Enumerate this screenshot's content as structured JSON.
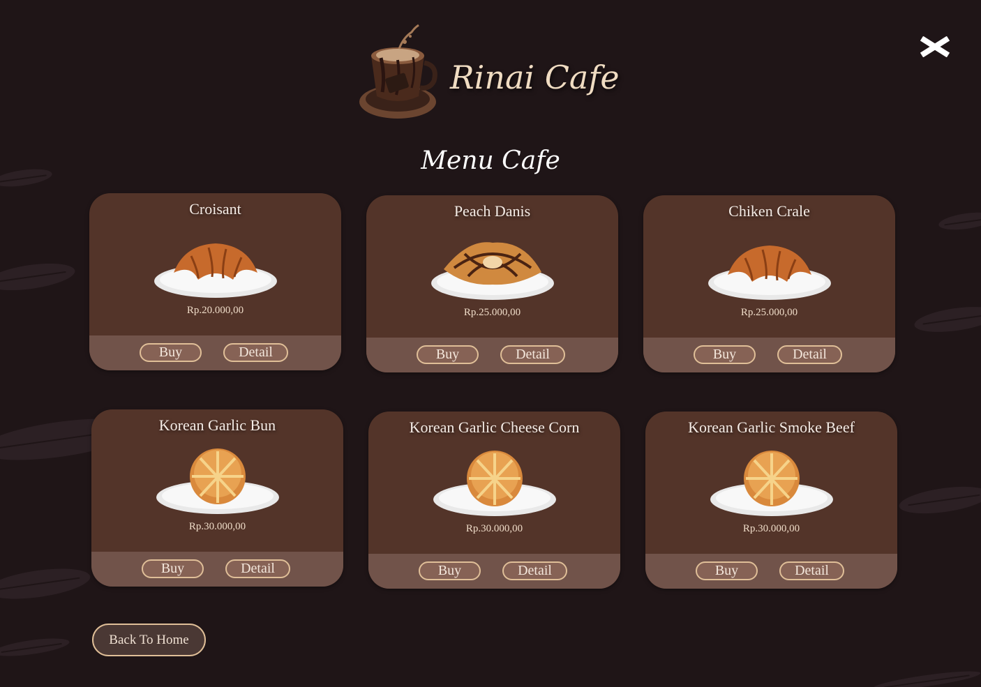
{
  "app": {
    "brand": "Rinai Cafe",
    "menu_title": "Menu Cafe"
  },
  "icons": {
    "logo": "coffee-cup-logo-icon",
    "close": "close-icon"
  },
  "colors": {
    "background": "#1f1517",
    "card": "#533429",
    "card_footer": "#71534a",
    "button_border": "#e0bf98",
    "brand_text": "#f0dcc2"
  },
  "menu": {
    "buy_label": "Buy",
    "detail_label": "Detail",
    "items": [
      {
        "name": "Croisant",
        "price": "Rp.20.000,00",
        "image": "croissant"
      },
      {
        "name": "Peach Danis",
        "price": "Rp.25.000,00",
        "image": "danish"
      },
      {
        "name": "Chiken Crale",
        "price": "Rp.25.000,00",
        "image": "croissant"
      },
      {
        "name": "Korean Garlic Bun",
        "price": "Rp.30.000,00",
        "image": "bun"
      },
      {
        "name": "Korean Garlic Cheese Corn",
        "price": "Rp.30.000,00",
        "image": "bun"
      },
      {
        "name": "Korean Garlic Smoke Beef",
        "price": "Rp.30.000,00",
        "image": "bun"
      }
    ]
  },
  "footer": {
    "back_label": "Back To Home"
  }
}
